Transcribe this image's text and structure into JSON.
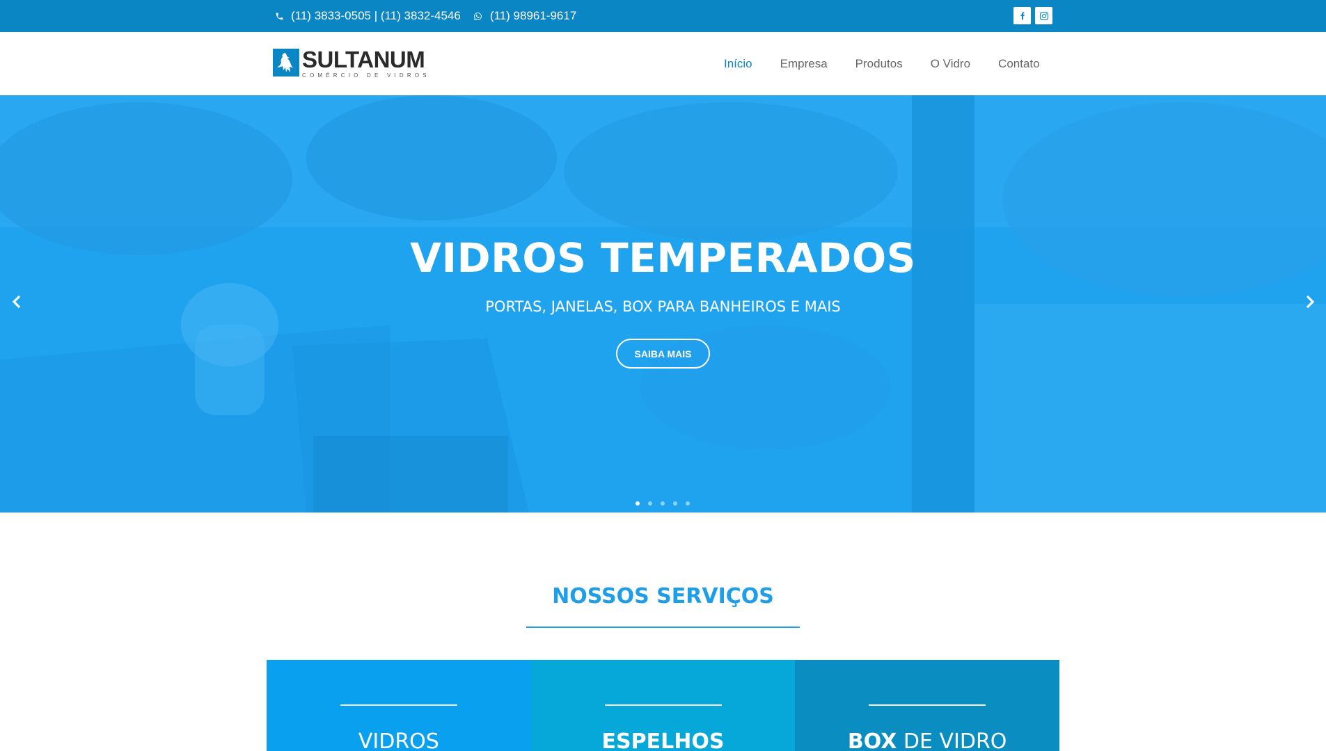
{
  "topbar": {
    "phones": "(11) 3833-0505 | (11) 3832-4546",
    "whatsapp": "(11) 98961-9617"
  },
  "logo": {
    "name": "SULTANUM",
    "subtitle": "COMÉRCIO DE VIDROS"
  },
  "nav": {
    "items": [
      "Início",
      "Empresa",
      "Produtos",
      "O Vidro",
      "Contato"
    ],
    "active": "Início"
  },
  "hero": {
    "title": "VIDROS TEMPERADOS",
    "subtitle": "PORTAS, JANELAS, BOX PARA BANHEIROS E MAIS",
    "button": "SAIBA MAIS",
    "slide_count": 5,
    "active_slide": 1
  },
  "services": {
    "title_light": "NOSSOS",
    "title_bold": "SERVIÇOS",
    "cards": [
      {
        "bold": "",
        "light": "VIDROS",
        "color": "#0aa0f0"
      },
      {
        "bold": "ESPELHOS",
        "light": "",
        "color": "#05a8d8"
      },
      {
        "bold": "BOX",
        "light": " DE VIDRO",
        "color": "#0a8ec2"
      }
    ]
  },
  "colors": {
    "topbar": "#0a86c4",
    "accent": "#1e9ee6",
    "hero_overlay": "#18a0f0"
  }
}
